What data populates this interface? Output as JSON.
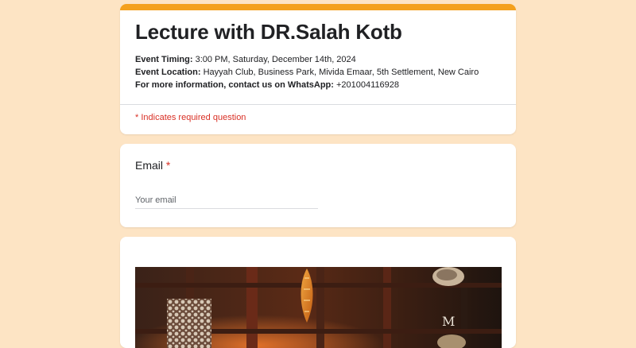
{
  "form": {
    "title": "Lecture with DR.Salah Kotb",
    "timing_label": "Event Timing:",
    "timing_value": " 3:00 PM, Saturday, December 14th, 2024",
    "location_label": "Event Location:",
    "location_value": " Hayyah Club, Business Park, Mivida Emaar, 5th Settlement, New Cairo",
    "contact_label": "For more information, contact us on WhatsApp:",
    "contact_value": " +201004116928",
    "required_note": "* Indicates required question",
    "accent_color": "#f4a01c",
    "required_color": "#d93025"
  },
  "email_question": {
    "label": "Email",
    "required_marker": "*",
    "placeholder": "Your email",
    "value": ""
  },
  "image_section": {
    "image_name": "lecture-banner-image"
  }
}
